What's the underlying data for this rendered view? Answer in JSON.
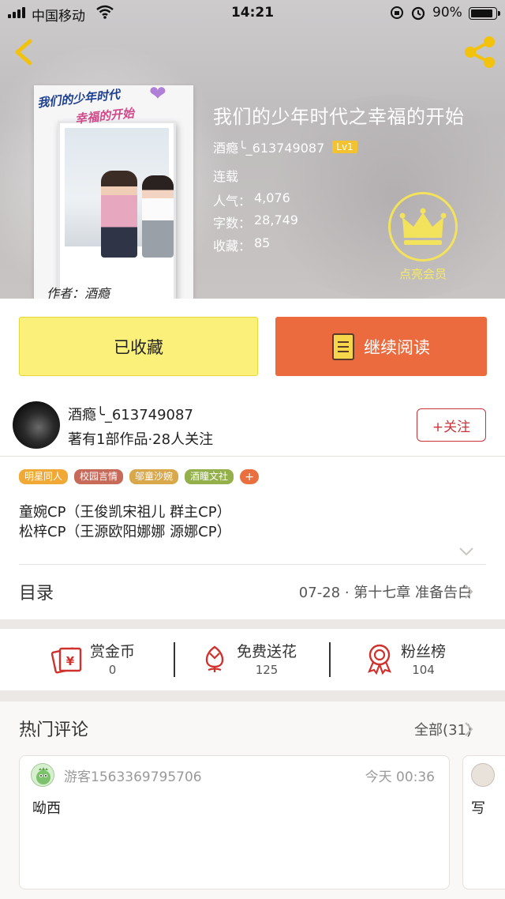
{
  "status_bar": {
    "carrier": "中国移动",
    "time": "14:21",
    "battery": "90%"
  },
  "book": {
    "title": "我们的少年时代之幸福的开始",
    "author": "酒瘾╰_613749087",
    "level": "Lv1",
    "status": "连载",
    "stats": [
      {
        "label": "人气：",
        "value": "4,076"
      },
      {
        "label": "字数：",
        "value": "28,749"
      },
      {
        "label": "收藏：",
        "value": "85"
      }
    ],
    "cover_text_line1": "我们的少年时代",
    "cover_text_line2": "幸福的开始",
    "cover_author": "作者：酒瘾"
  },
  "vip": {
    "label": "点亮会员",
    "color": "#f3e25b"
  },
  "actions": {
    "collected_label": "已收藏",
    "read_label": "继续阅读"
  },
  "author_card": {
    "name": "酒瘾╰_613749087",
    "summary": "著有1部作品·28人关注",
    "follow_label": "+关注"
  },
  "tags": [
    {
      "label": "明星同人",
      "color": "#f0a935"
    },
    {
      "label": "校园言情",
      "color": "#c86a5a"
    },
    {
      "label": "邬童沙婉",
      "color": "#d8a84a"
    },
    {
      "label": "酒瞳文社",
      "color": "#93b04b"
    }
  ],
  "description": [
    "童婉CP（王俊凯宋祖儿  群主CP）",
    "松梓CP（王源欧阳娜娜  源娜CP）"
  ],
  "catalog": {
    "title": "目录",
    "latest": "07-28 · 第十七章  准备告白"
  },
  "stats_row": [
    {
      "label": "赏金币",
      "value": "0",
      "icon": "red-envelope-icon"
    },
    {
      "label": "免费送花",
      "value": "125",
      "icon": "flower-icon"
    },
    {
      "label": "粉丝榜",
      "value": "104",
      "icon": "medal-icon"
    }
  ],
  "comments_section": {
    "title": "热门评论",
    "all_label": "全部(31)"
  },
  "comments": [
    {
      "user": "游客1563369795706",
      "time": "今天 00:36",
      "text": "呦西"
    },
    {
      "user": "",
      "time": "",
      "text": "写"
    }
  ],
  "colors": {
    "accent": "#eb6b3f",
    "collected_bg": "#fbf07a",
    "follow": "#c8343a"
  }
}
